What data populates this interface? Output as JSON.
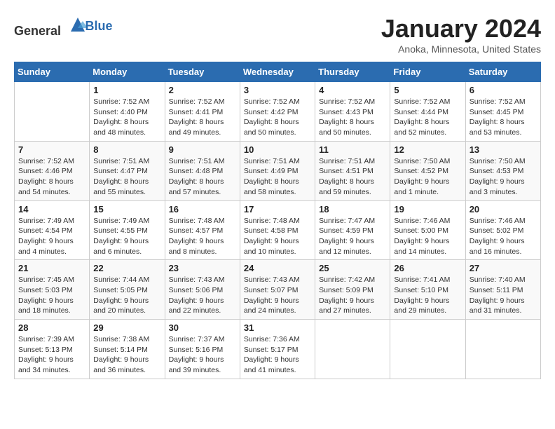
{
  "header": {
    "logo_general": "General",
    "logo_blue": "Blue",
    "month_title": "January 2024",
    "location": "Anoka, Minnesota, United States"
  },
  "weekdays": [
    "Sunday",
    "Monday",
    "Tuesday",
    "Wednesday",
    "Thursday",
    "Friday",
    "Saturday"
  ],
  "weeks": [
    [
      {
        "day": "",
        "sunrise": "",
        "sunset": "",
        "daylight": ""
      },
      {
        "day": "1",
        "sunrise": "Sunrise: 7:52 AM",
        "sunset": "Sunset: 4:40 PM",
        "daylight": "Daylight: 8 hours and 48 minutes."
      },
      {
        "day": "2",
        "sunrise": "Sunrise: 7:52 AM",
        "sunset": "Sunset: 4:41 PM",
        "daylight": "Daylight: 8 hours and 49 minutes."
      },
      {
        "day": "3",
        "sunrise": "Sunrise: 7:52 AM",
        "sunset": "Sunset: 4:42 PM",
        "daylight": "Daylight: 8 hours and 50 minutes."
      },
      {
        "day": "4",
        "sunrise": "Sunrise: 7:52 AM",
        "sunset": "Sunset: 4:43 PM",
        "daylight": "Daylight: 8 hours and 50 minutes."
      },
      {
        "day": "5",
        "sunrise": "Sunrise: 7:52 AM",
        "sunset": "Sunset: 4:44 PM",
        "daylight": "Daylight: 8 hours and 52 minutes."
      },
      {
        "day": "6",
        "sunrise": "Sunrise: 7:52 AM",
        "sunset": "Sunset: 4:45 PM",
        "daylight": "Daylight: 8 hours and 53 minutes."
      }
    ],
    [
      {
        "day": "7",
        "sunrise": "Sunrise: 7:52 AM",
        "sunset": "Sunset: 4:46 PM",
        "daylight": "Daylight: 8 hours and 54 minutes."
      },
      {
        "day": "8",
        "sunrise": "Sunrise: 7:51 AM",
        "sunset": "Sunset: 4:47 PM",
        "daylight": "Daylight: 8 hours and 55 minutes."
      },
      {
        "day": "9",
        "sunrise": "Sunrise: 7:51 AM",
        "sunset": "Sunset: 4:48 PM",
        "daylight": "Daylight: 8 hours and 57 minutes."
      },
      {
        "day": "10",
        "sunrise": "Sunrise: 7:51 AM",
        "sunset": "Sunset: 4:49 PM",
        "daylight": "Daylight: 8 hours and 58 minutes."
      },
      {
        "day": "11",
        "sunrise": "Sunrise: 7:51 AM",
        "sunset": "Sunset: 4:51 PM",
        "daylight": "Daylight: 8 hours and 59 minutes."
      },
      {
        "day": "12",
        "sunrise": "Sunrise: 7:50 AM",
        "sunset": "Sunset: 4:52 PM",
        "daylight": "Daylight: 9 hours and 1 minute."
      },
      {
        "day": "13",
        "sunrise": "Sunrise: 7:50 AM",
        "sunset": "Sunset: 4:53 PM",
        "daylight": "Daylight: 9 hours and 3 minutes."
      }
    ],
    [
      {
        "day": "14",
        "sunrise": "Sunrise: 7:49 AM",
        "sunset": "Sunset: 4:54 PM",
        "daylight": "Daylight: 9 hours and 4 minutes."
      },
      {
        "day": "15",
        "sunrise": "Sunrise: 7:49 AM",
        "sunset": "Sunset: 4:55 PM",
        "daylight": "Daylight: 9 hours and 6 minutes."
      },
      {
        "day": "16",
        "sunrise": "Sunrise: 7:48 AM",
        "sunset": "Sunset: 4:57 PM",
        "daylight": "Daylight: 9 hours and 8 minutes."
      },
      {
        "day": "17",
        "sunrise": "Sunrise: 7:48 AM",
        "sunset": "Sunset: 4:58 PM",
        "daylight": "Daylight: 9 hours and 10 minutes."
      },
      {
        "day": "18",
        "sunrise": "Sunrise: 7:47 AM",
        "sunset": "Sunset: 4:59 PM",
        "daylight": "Daylight: 9 hours and 12 minutes."
      },
      {
        "day": "19",
        "sunrise": "Sunrise: 7:46 AM",
        "sunset": "Sunset: 5:00 PM",
        "daylight": "Daylight: 9 hours and 14 minutes."
      },
      {
        "day": "20",
        "sunrise": "Sunrise: 7:46 AM",
        "sunset": "Sunset: 5:02 PM",
        "daylight": "Daylight: 9 hours and 16 minutes."
      }
    ],
    [
      {
        "day": "21",
        "sunrise": "Sunrise: 7:45 AM",
        "sunset": "Sunset: 5:03 PM",
        "daylight": "Daylight: 9 hours and 18 minutes."
      },
      {
        "day": "22",
        "sunrise": "Sunrise: 7:44 AM",
        "sunset": "Sunset: 5:05 PM",
        "daylight": "Daylight: 9 hours and 20 minutes."
      },
      {
        "day": "23",
        "sunrise": "Sunrise: 7:43 AM",
        "sunset": "Sunset: 5:06 PM",
        "daylight": "Daylight: 9 hours and 22 minutes."
      },
      {
        "day": "24",
        "sunrise": "Sunrise: 7:43 AM",
        "sunset": "Sunset: 5:07 PM",
        "daylight": "Daylight: 9 hours and 24 minutes."
      },
      {
        "day": "25",
        "sunrise": "Sunrise: 7:42 AM",
        "sunset": "Sunset: 5:09 PM",
        "daylight": "Daylight: 9 hours and 27 minutes."
      },
      {
        "day": "26",
        "sunrise": "Sunrise: 7:41 AM",
        "sunset": "Sunset: 5:10 PM",
        "daylight": "Daylight: 9 hours and 29 minutes."
      },
      {
        "day": "27",
        "sunrise": "Sunrise: 7:40 AM",
        "sunset": "Sunset: 5:11 PM",
        "daylight": "Daylight: 9 hours and 31 minutes."
      }
    ],
    [
      {
        "day": "28",
        "sunrise": "Sunrise: 7:39 AM",
        "sunset": "Sunset: 5:13 PM",
        "daylight": "Daylight: 9 hours and 34 minutes."
      },
      {
        "day": "29",
        "sunrise": "Sunrise: 7:38 AM",
        "sunset": "Sunset: 5:14 PM",
        "daylight": "Daylight: 9 hours and 36 minutes."
      },
      {
        "day": "30",
        "sunrise": "Sunrise: 7:37 AM",
        "sunset": "Sunset: 5:16 PM",
        "daylight": "Daylight: 9 hours and 39 minutes."
      },
      {
        "day": "31",
        "sunrise": "Sunrise: 7:36 AM",
        "sunset": "Sunset: 5:17 PM",
        "daylight": "Daylight: 9 hours and 41 minutes."
      },
      {
        "day": "",
        "sunrise": "",
        "sunset": "",
        "daylight": ""
      },
      {
        "day": "",
        "sunrise": "",
        "sunset": "",
        "daylight": ""
      },
      {
        "day": "",
        "sunrise": "",
        "sunset": "",
        "daylight": ""
      }
    ]
  ]
}
